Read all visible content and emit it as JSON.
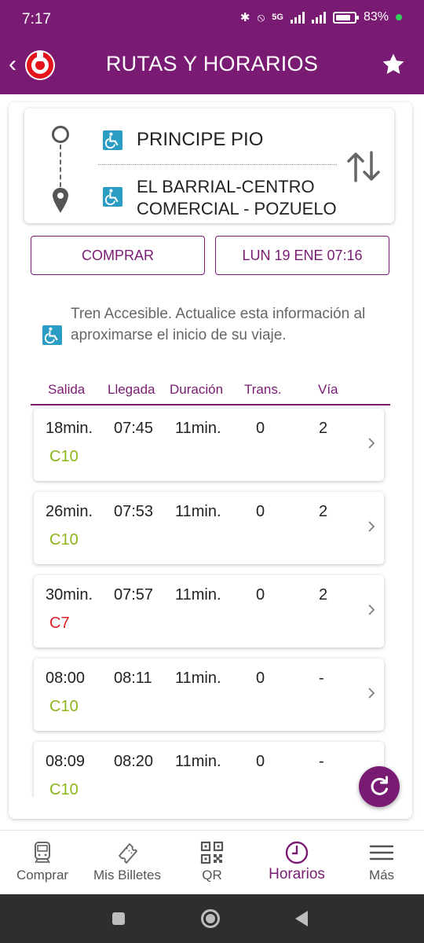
{
  "status_bar": {
    "time": "7:17",
    "network": "5G",
    "battery_percent_label": "83%",
    "battery_level": 0.83
  },
  "app_bar": {
    "title": "RUTAS Y HORARIOS",
    "brand_color": "#7a1b73",
    "logo_color": "#e3141b"
  },
  "route": {
    "origin": "PRINCIPE PIO",
    "destination": "EL BARRIAL-CENTRO COMERCIAL - POZUELO"
  },
  "actions": {
    "buy_label": "COMPRAR",
    "datetime_label": "LUN 19 ENE 07:16"
  },
  "notice": {
    "text": "Tren Accesible. Actualice esta información al aproximarse el inicio de su viaje."
  },
  "table": {
    "headers": {
      "salida": "Salida",
      "llegada": "Llegada",
      "duracion": "Duración",
      "trans": "Trans.",
      "via": "Vía"
    },
    "rows": [
      {
        "salida": "18min.",
        "llegada": "07:45",
        "duracion": "11min.",
        "trans": "0",
        "via": "2",
        "line": "C10",
        "line_color": "#8db51a"
      },
      {
        "salida": "26min.",
        "llegada": "07:53",
        "duracion": "11min.",
        "trans": "0",
        "via": "2",
        "line": "C10",
        "line_color": "#8db51a"
      },
      {
        "salida": "30min.",
        "llegada": "07:57",
        "duracion": "11min.",
        "trans": "0",
        "via": "2",
        "line": "C7",
        "line_color": "#d92027"
      },
      {
        "salida": "08:00",
        "llegada": "08:11",
        "duracion": "11min.",
        "trans": "0",
        "via": "-",
        "line": "C10",
        "line_color": "#8db51a"
      },
      {
        "salida": "08:09",
        "llegada": "08:20",
        "duracion": "11min.",
        "trans": "0",
        "via": "-",
        "line": "C10",
        "line_color": "#8db51a"
      }
    ]
  },
  "bottom_nav": {
    "items": [
      {
        "label": "Comprar",
        "icon": "train-icon"
      },
      {
        "label": "Mis Billetes",
        "icon": "ticket-icon"
      },
      {
        "label": "QR",
        "icon": "qr-icon"
      },
      {
        "label": "Horarios",
        "icon": "clock-icon",
        "active": true
      },
      {
        "label": "Más",
        "icon": "menu-icon"
      }
    ]
  },
  "colors": {
    "accent": "#7a1b73",
    "accessible_icon": "#2c9dc2"
  }
}
